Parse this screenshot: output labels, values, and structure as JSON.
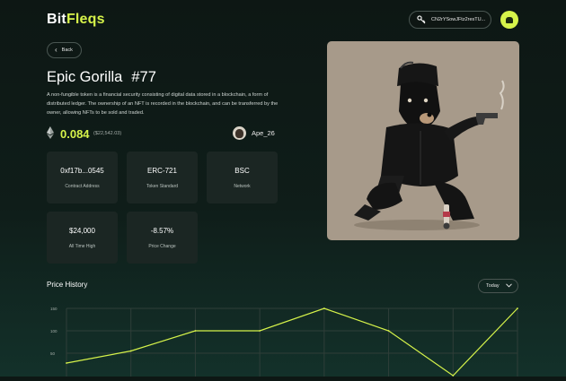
{
  "brand": {
    "name_part1": "Bit",
    "name_part2": "Fleqs"
  },
  "header": {
    "wallet_address": "CN2rYSowJFtz2resTU...",
    "wallet_icon": "key-icon",
    "profile_icon": "user-icon"
  },
  "back_button": {
    "label": "Back"
  },
  "nft": {
    "name": "Epic Gorilla",
    "number": "#77",
    "description": "A non-fungible token is a financial security consisting of digital data stored in a blockchain, a form of distributed ledger. The ownership of an NFT is recorded in the blockchain, and can be transferred by the owner, allowing NFTs to be sold and traded.",
    "price_eth": "0.084",
    "price_usd": "($22,542.03)",
    "owner": "Ape_26"
  },
  "stats": [
    {
      "value": "0xf17b...0545",
      "label": "Contract Address"
    },
    {
      "value": "ERC-721",
      "label": "Token Standard"
    },
    {
      "value": "BSC",
      "label": "Network"
    },
    {
      "value": "$24,000",
      "label": "All Time High"
    },
    {
      "value": "-8.57%",
      "label": "Price Change"
    }
  ],
  "price_history": {
    "title": "Price History",
    "range": "Today",
    "accent_color": "#d6f34a"
  },
  "chart_data": {
    "type": "line",
    "title": "Price History",
    "xlabel": "",
    "ylabel": "",
    "y_ticks": [
      "150",
      "100",
      "50"
    ],
    "x": [
      0,
      1,
      2,
      3,
      4,
      5,
      6,
      7
    ],
    "series": [
      {
        "values": [
          28,
          55,
          100,
          100,
          150,
          100,
          0,
          150
        ]
      }
    ],
    "ylim": [
      0,
      150
    ],
    "grid": true
  }
}
